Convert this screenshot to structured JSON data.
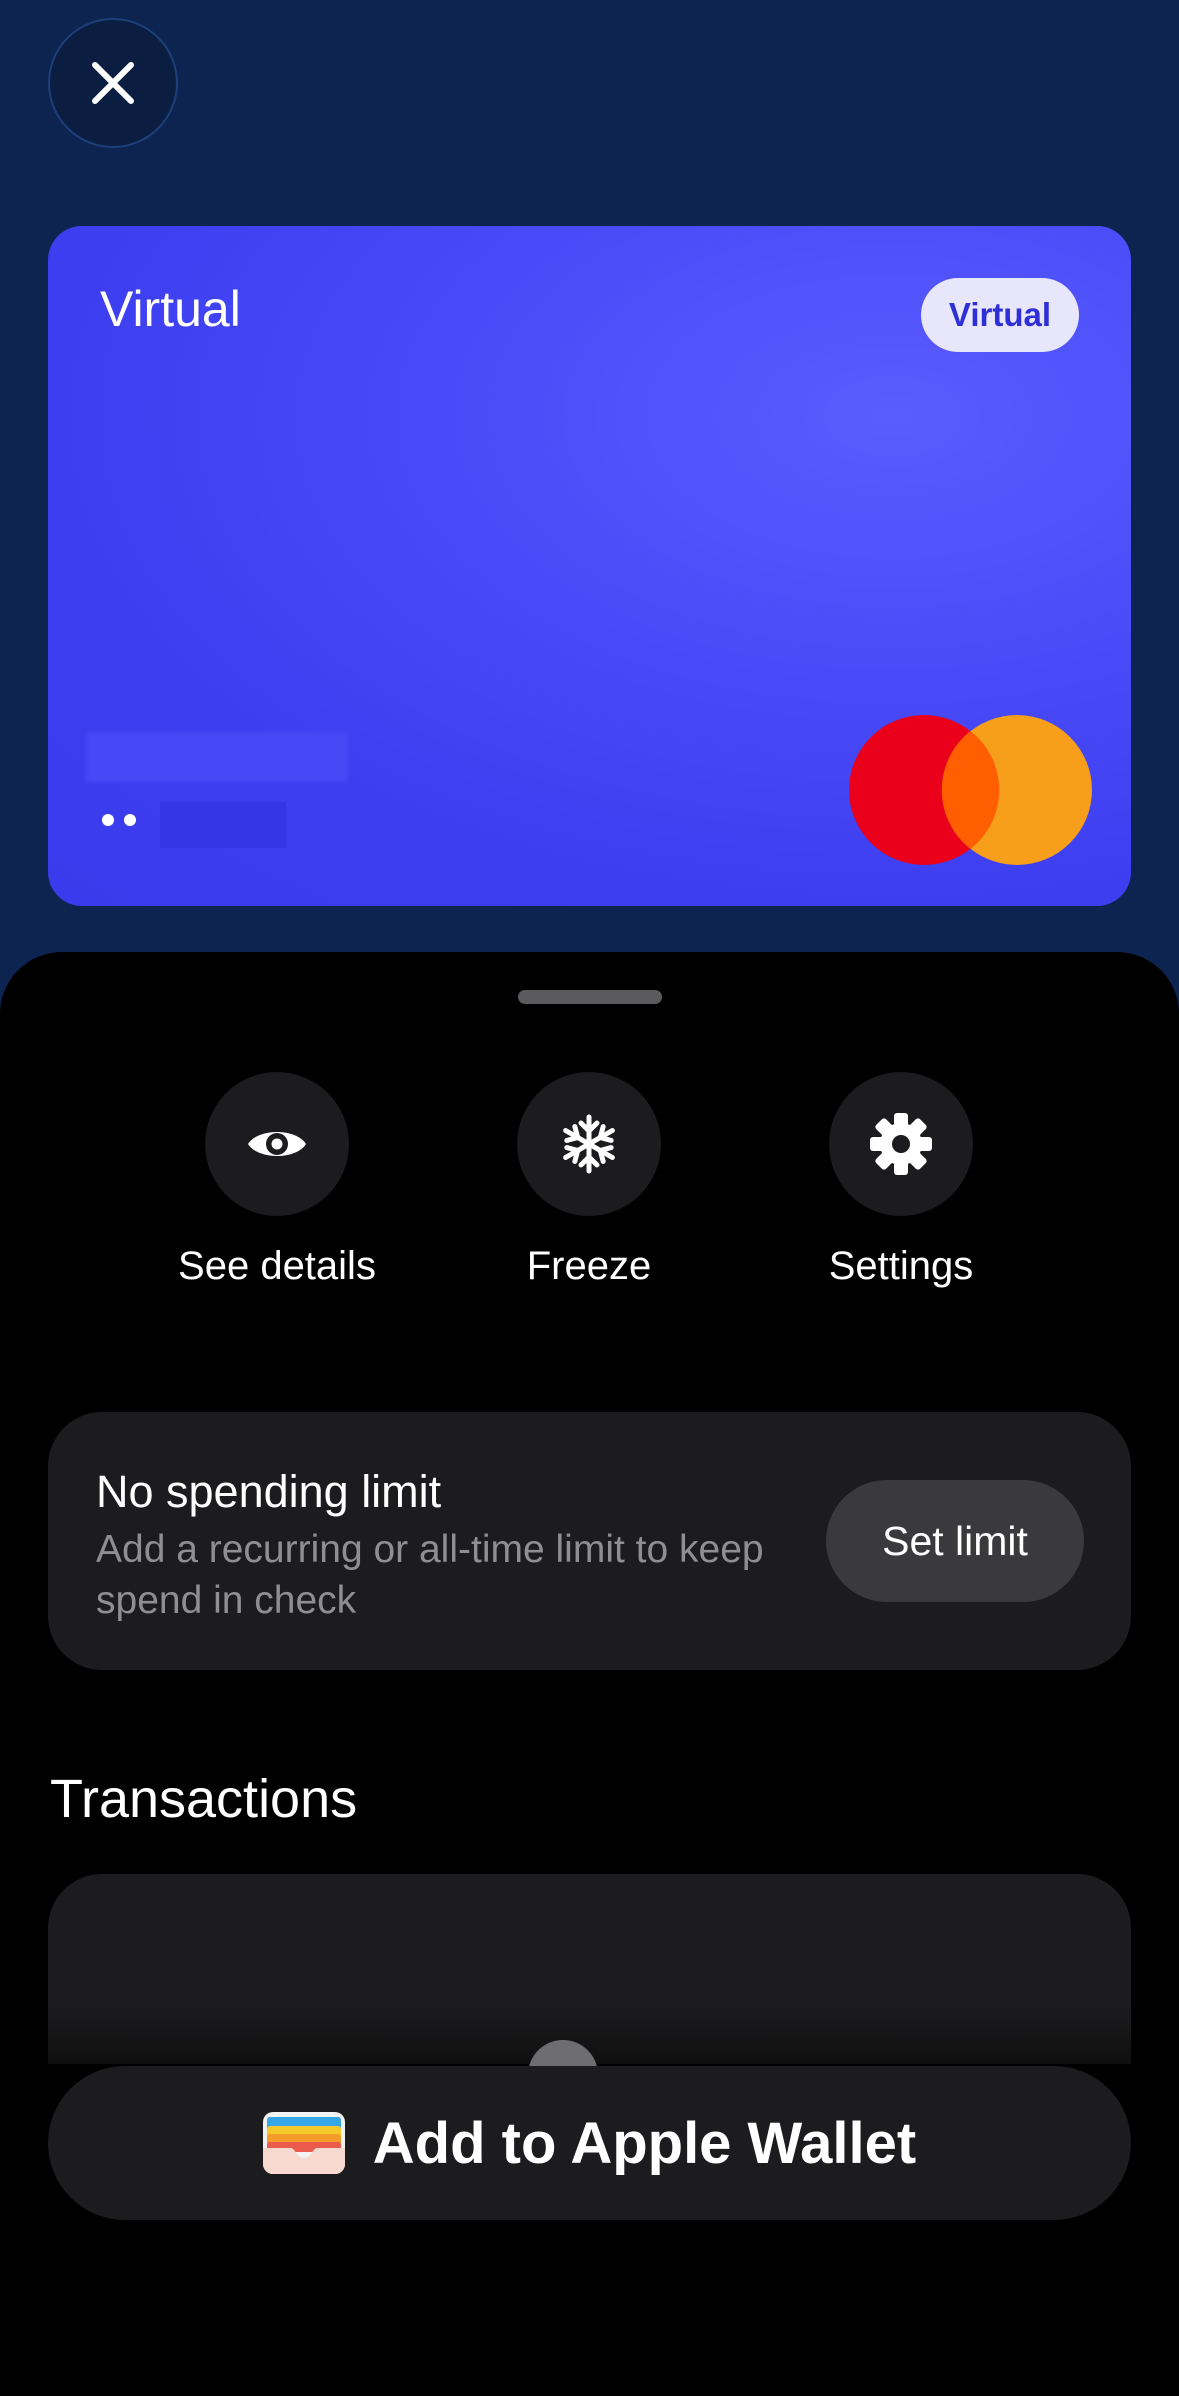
{
  "close_button": {
    "icon": "close-icon"
  },
  "card": {
    "title": "Virtual",
    "badge": "Virtual",
    "masked_prefix": "••",
    "network": "mastercard-logo",
    "colors": {
      "card": "#3d3ef0",
      "badge_bg": "#e7e6fb",
      "badge_text": "#2e2fd6",
      "mc_red": "#eb001b",
      "mc_orange": "#f79e1b"
    }
  },
  "actions": [
    {
      "label": "See details",
      "icon": "eye-icon"
    },
    {
      "label": "Freeze",
      "icon": "snowflake-icon"
    },
    {
      "label": "Settings",
      "icon": "gear-icon"
    }
  ],
  "limit": {
    "title": "No spending limit",
    "description": "Add a recurring or all-time limit to keep spend in check",
    "button": "Set limit"
  },
  "transactions": {
    "title": "Transactions"
  },
  "wallet": {
    "label": "Add to Apple Wallet",
    "icon": "apple-wallet-icon"
  },
  "colors": {
    "background": "#0e2450",
    "sheet": "#000000",
    "surface": "#1c1c1e"
  }
}
